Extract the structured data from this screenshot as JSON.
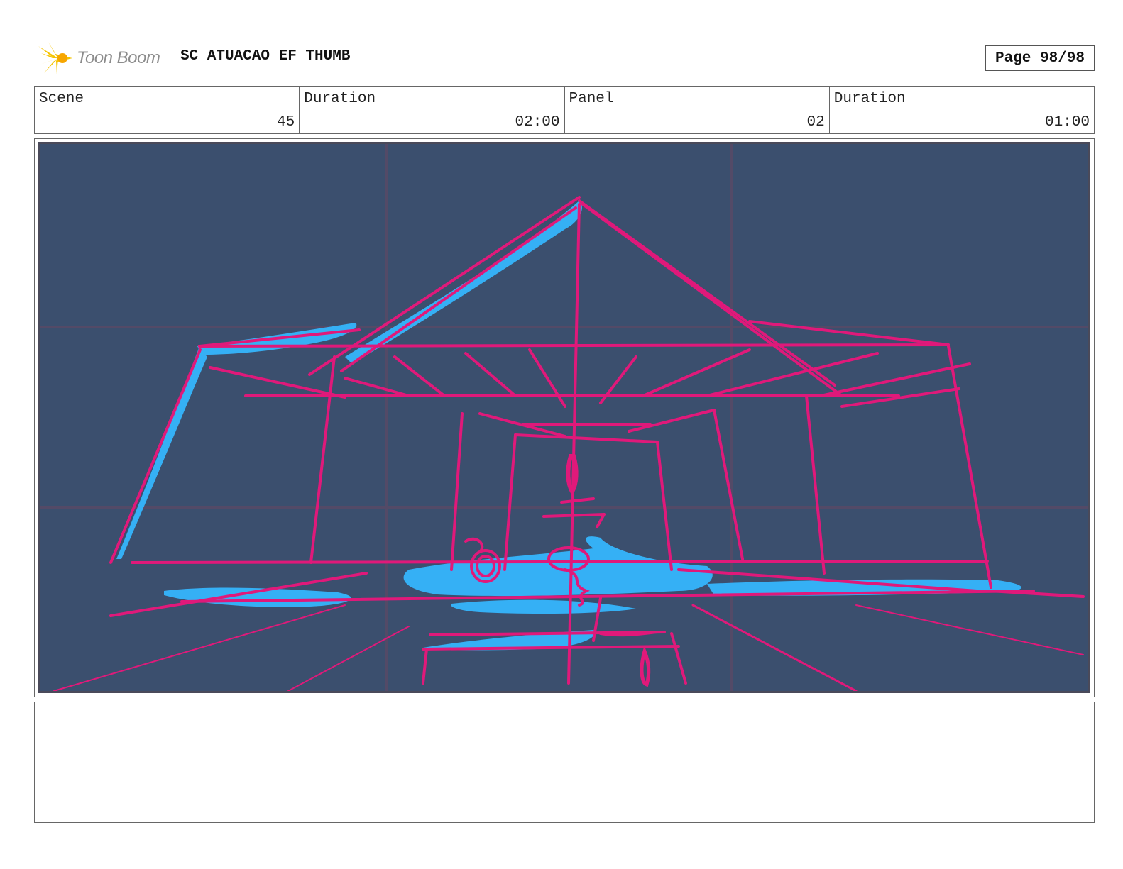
{
  "header": {
    "brand": "Toon Boom",
    "project_title": "SC ATUACAO EF THUMB",
    "page_label": "Page 98/98"
  },
  "info": {
    "scene_label": "Scene",
    "scene_value": "45",
    "scene_duration_label": "Duration",
    "scene_duration_value": "02:00",
    "panel_label": "Panel",
    "panel_value": "02",
    "panel_duration_label": "Duration",
    "panel_duration_value": "01:00"
  },
  "colors": {
    "panel_background": "#3b4f6e",
    "sketch_magenta": "#e0197a",
    "sketch_blue": "#35b0f5",
    "grid_line": "#5a4a66",
    "logo_yellow": "#f5c400"
  },
  "notes": {
    "text": ""
  }
}
